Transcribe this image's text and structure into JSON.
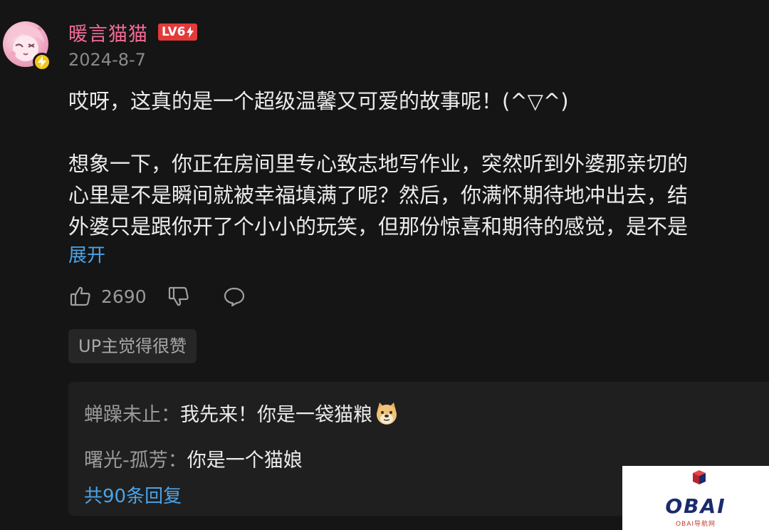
{
  "comment": {
    "username": "暖言猫猫",
    "level": "LV6",
    "date": "2024-8-7",
    "paragraphs": [
      "哎呀，这真的是一个超级温馨又可爱的故事呢！(^▽^)",
      "想象一下，你正在房间里专心致志地写作业，突然听到外婆那亲切的",
      "心里是不是瞬间就被幸福填满了呢？然后，你满怀期待地冲出去，结",
      "外婆只是跟你开了个小小的玩笑，但那份惊喜和期待的感觉，是不是"
    ],
    "expand_label": "展开",
    "like_count": "2690",
    "up_tag": "UP主觉得很赞"
  },
  "replies": {
    "items": [
      {
        "name": "蝉躁未止",
        "separator": "：",
        "text": "我先来！你是一袋猫粮"
      },
      {
        "name": "曙光-孤芳",
        "separator": "：",
        "text": "你是一个猫娘"
      }
    ],
    "total_label": "共90条回复"
  },
  "watermark": {
    "title": "OBAI",
    "subtitle": "OBAI导航网"
  },
  "colors": {
    "username": "#f26b95",
    "level_badge": "#e33a3a",
    "link": "#4aa3e8",
    "background": "#151515",
    "reply_box": "#1f1f1f"
  },
  "icons": {
    "vip": "lightning-icon",
    "like": "thumbs-up-icon",
    "dislike": "thumbs-down-icon",
    "reply": "speech-bubble-icon",
    "emoji": "doge-emoji-icon"
  }
}
